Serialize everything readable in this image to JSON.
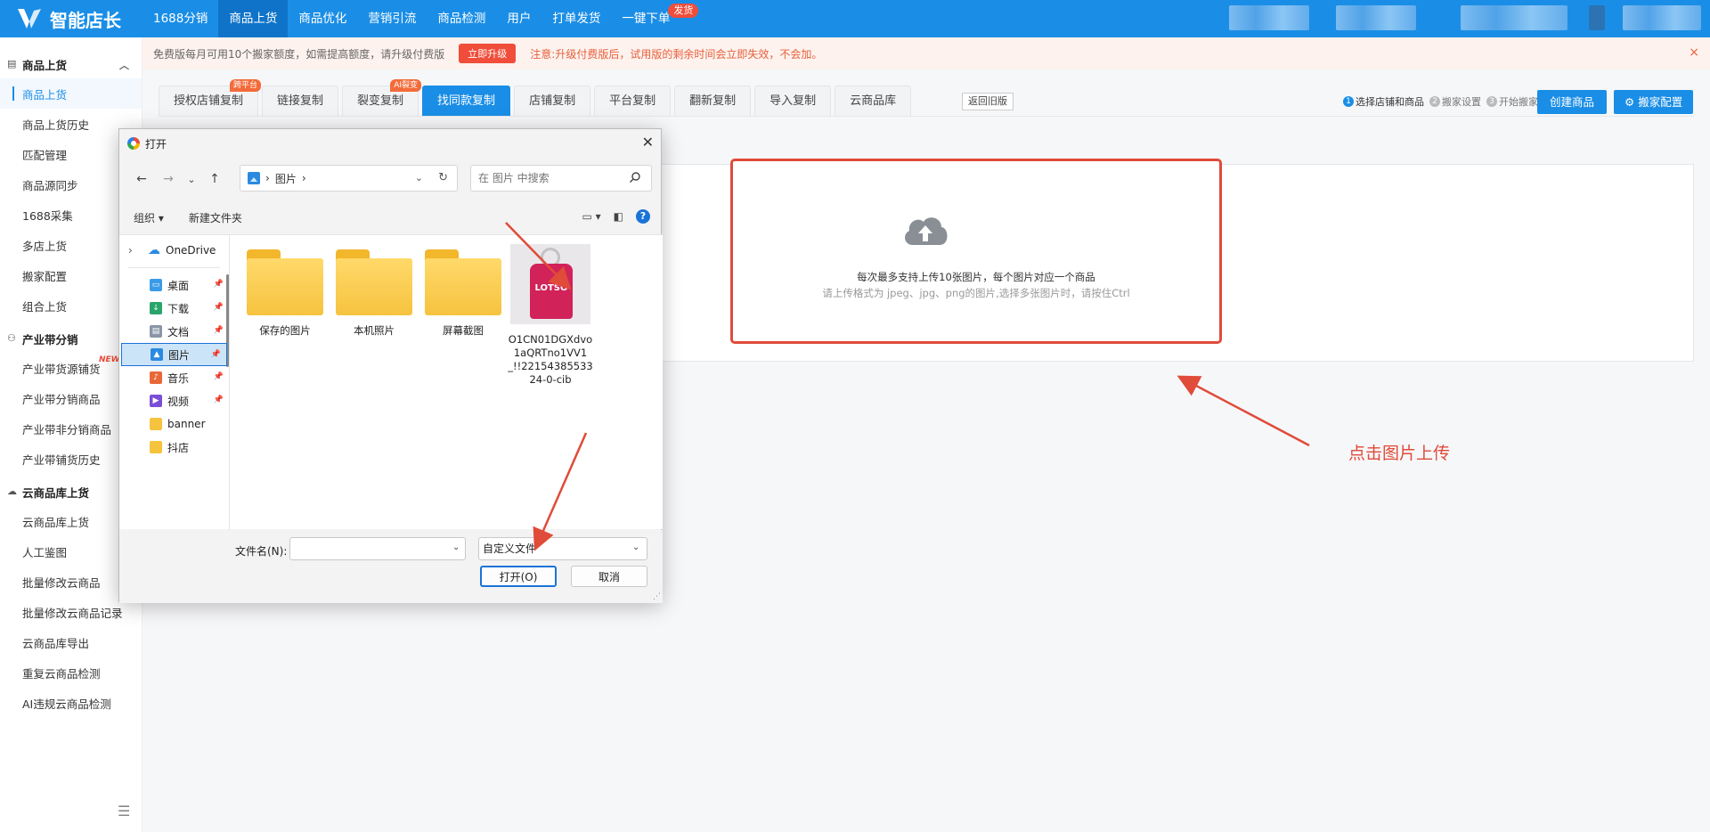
{
  "app": {
    "brand": "智能店长"
  },
  "nav": {
    "items": [
      "1688分销",
      "商品上货",
      "商品优化",
      "营销引流",
      "商品检测",
      "用户",
      "打单发货",
      "一键下单"
    ],
    "active_index": 1,
    "badge": "发货"
  },
  "notice": {
    "text": "免费版每月可用10个搬家额度，如需提高额度，请升级付费版",
    "button": "立即升级",
    "warning": "注意:升级付费版后，试用版的剩余时间会立即失效，不会加。",
    "close": "×"
  },
  "sidebar": {
    "groups": [
      {
        "title": "商品上货",
        "items": [
          "商品上货",
          "商品上货历史",
          "匹配管理",
          "商品源同步",
          "1688采集",
          "多店上货",
          "搬家配置",
          "组合上货"
        ]
      },
      {
        "title": "产业带分销",
        "items": [
          "产业带货源铺货",
          "产业带分销商品",
          "产业带非分销商品",
          "产业带铺货历史"
        ],
        "new_badge": "NEW"
      },
      {
        "title": "云商品库上货",
        "items": [
          "云商品库上货",
          "人工鉴图",
          "批量修改云商品",
          "批量修改云商品记录",
          "云商品库导出",
          "重复云商品检测",
          "AI违规云商品检测"
        ]
      }
    ],
    "active_item": "商品上货"
  },
  "tabs": {
    "items": [
      {
        "label": "授权店铺复制",
        "badge": "跨平台"
      },
      {
        "label": "链接复制",
        "badge": ""
      },
      {
        "label": "裂变复制",
        "badge": "AI裂变"
      },
      {
        "label": "找同款复制",
        "badge": ""
      },
      {
        "label": "店铺复制",
        "badge": ""
      },
      {
        "label": "平台复制",
        "badge": ""
      },
      {
        "label": "翻新复制",
        "badge": ""
      },
      {
        "label": "导入复制",
        "badge": ""
      },
      {
        "label": "云商品库",
        "badge": ""
      }
    ],
    "active_index": 3,
    "old_version": "返回旧版"
  },
  "steps": [
    {
      "num": "1",
      "label": "选择店铺和商品",
      "active": true
    },
    {
      "num": "2",
      "label": "搬家设置",
      "active": false
    },
    {
      "num": "3",
      "label": "开始搬家",
      "active": false
    }
  ],
  "buttons": {
    "create": "创建商品",
    "config": "搬家配置"
  },
  "upload": {
    "title": "每次最多支持上传10张图片，每个图片对应一个商品",
    "hint": "请上传格式为 jpeg、jpg、png的图片,选择多张图片时，请按住Ctrl"
  },
  "annotation": "点击图片上传",
  "dialog": {
    "title": "打开",
    "address": "图片",
    "search_placeholder": "在 图片 中搜索",
    "toolbar": {
      "organize": "组织 ▾",
      "new_folder": "新建文件夹"
    },
    "nav_pane": [
      {
        "label": "OneDrive",
        "icon": "cloud-icon",
        "pinned": false
      },
      {
        "label": "桌面",
        "icon": "desktop-icon",
        "pinned": true
      },
      {
        "label": "下载",
        "icon": "download-icon",
        "pinned": true
      },
      {
        "label": "文档",
        "icon": "document-icon",
        "pinned": true
      },
      {
        "label": "图片",
        "icon": "pictures-icon",
        "pinned": true
      },
      {
        "label": "音乐",
        "icon": "music-icon",
        "pinned": true
      },
      {
        "label": "视频",
        "icon": "video-icon",
        "pinned": true
      },
      {
        "label": "banner",
        "icon": "folder-icon",
        "pinned": false
      },
      {
        "label": "抖店",
        "icon": "folder-icon",
        "pinned": false
      }
    ],
    "selected_nav": "图片",
    "files": [
      {
        "name": "保存的图片",
        "type": "folder"
      },
      {
        "name": "本机照片",
        "type": "folder"
      },
      {
        "name": "屏幕截图",
        "type": "folder"
      },
      {
        "name": "O1CN01DGXdvo1aQRTno1VV1_!!2215438553324-0-cib",
        "type": "image",
        "thumb_text": "LOTSO"
      }
    ],
    "filename_label": "文件名(N):",
    "filename_value": "",
    "filetype": "自定义文件",
    "open_button": "打开(O)",
    "cancel_button": "取消"
  },
  "colors": {
    "brand": "#1a8ee6",
    "accent_red": "#e04b3a"
  }
}
